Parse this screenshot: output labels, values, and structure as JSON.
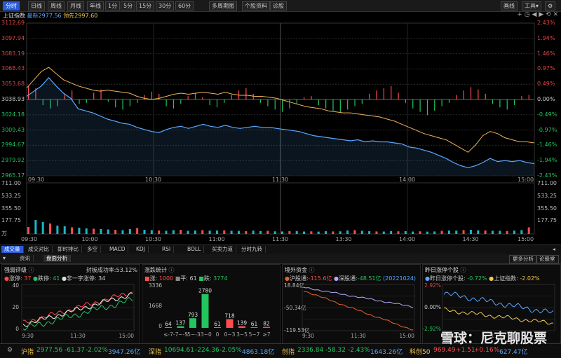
{
  "toolbar": {
    "tabs": [
      "分时",
      "日线",
      "周线",
      "月线",
      "年线",
      "1分",
      "5分",
      "15分",
      "30分",
      "60分"
    ],
    "more_period": "多周期图",
    "stock_info": "个股资料",
    "diagnose": "诊股",
    "draw_line": "画线",
    "tools": "工具",
    "tools_caret": "▾"
  },
  "legend": {
    "index_name": "上证指数",
    "latest_label": "最新",
    "latest_value": "2977.56",
    "lead_label": "领先",
    "lead_value": "2997.60"
  },
  "chart_data": {
    "type": "line",
    "price_levels": [
      "3112.69",
      "3097.94",
      "3083.19",
      "3068.43",
      "3053.68",
      "3038.93",
      "3024.18",
      "3009.43",
      "2994.67",
      "2979.92",
      "2965.17"
    ],
    "pct_levels": [
      "2.43%",
      "1.94%",
      "1.46%",
      "0.97%",
      "0.49%",
      "0.00%",
      "-0.49%",
      "-0.97%",
      "-1.46%",
      "-1.94%",
      "-2.43%"
    ],
    "prev_close": 3038.93,
    "time_labels": [
      "09:30",
      "10:30",
      "11:30",
      "14:00",
      "15:00"
    ],
    "volume_labels": [
      "711.00",
      "533.25",
      "355.50",
      "177.75",
      "万"
    ],
    "bottom_time_labels": [
      "09:30",
      "10:00",
      "10:30",
      "11:00",
      "11:30",
      "13:30",
      "14:00",
      "14:30",
      "15:00"
    ],
    "latest_series": [
      3042,
      3047,
      3052,
      3060,
      3052,
      3045,
      3040,
      3030,
      3028,
      3026,
      3023,
      3020,
      3018,
      3016,
      3015,
      3012,
      3010,
      3008,
      3007,
      3010,
      3012,
      3013,
      3011,
      3013,
      3015,
      3013,
      3012,
      3014,
      3012,
      3011,
      3012,
      3013,
      3012,
      3012,
      3011,
      3010,
      3009,
      3008,
      3006,
      3004,
      3003,
      3002,
      3001,
      3000,
      2999,
      3000,
      2998,
      2999,
      2998,
      2998,
      2997,
      2996,
      2993,
      2992,
      2990,
      2988,
      2985,
      2982,
      2978,
      2975,
      2973,
      2975,
      2978,
      2982,
      2979,
      2980,
      2979,
      2980,
      2978,
      2977
    ],
    "lead_series": [
      3050,
      3058,
      3066,
      3070,
      3064,
      3058,
      3055,
      3052,
      3050,
      3048,
      3047,
      3048,
      3047,
      3046,
      3045,
      3042,
      3040,
      3039,
      3040,
      3042,
      3044,
      3045,
      3044,
      3045,
      3046,
      3045,
      3044,
      3046,
      3044,
      3043,
      3043,
      3042,
      3042,
      3041,
      3040,
      3038,
      3036,
      3034,
      3032,
      3031,
      3030,
      3028,
      3027,
      3026,
      3026,
      3025,
      3024,
      3023,
      3022,
      3020,
      3018,
      3015,
      3012,
      3009,
      3006,
      3004,
      3002,
      3000,
      2996,
      2992,
      2988,
      2995,
      3004,
      3008,
      3006,
      3002,
      3000,
      2998,
      2998,
      2997
    ],
    "diff_bars": [
      12,
      10,
      -5,
      -8,
      -6,
      5,
      8,
      -4,
      -3,
      6,
      9,
      -2,
      -7,
      -9,
      -6,
      -3,
      4,
      7,
      5,
      -6,
      -8,
      -4,
      3,
      6,
      2,
      -5,
      -7,
      -3,
      4,
      8,
      10,
      5,
      -3,
      -6,
      -9,
      -11,
      -8,
      -4,
      2,
      3,
      -5,
      -8,
      -10,
      -12,
      -9,
      -6,
      -4,
      5,
      8,
      10,
      12,
      6,
      -3,
      -8,
      -11,
      -14,
      -10,
      -6,
      -3,
      4,
      8,
      11,
      9,
      5,
      -4,
      -7,
      -9,
      -5,
      3,
      4
    ],
    "volume_bars": [
      100,
      200,
      170,
      150,
      120,
      110,
      95,
      90,
      80,
      75,
      70,
      65,
      60,
      55,
      70,
      85,
      60,
      55,
      50,
      45,
      55,
      60,
      45,
      50,
      55,
      48,
      50,
      52,
      46,
      44,
      40,
      48,
      42,
      45,
      38,
      36,
      40,
      42,
      35,
      38,
      34,
      40,
      36,
      38,
      50,
      55,
      45,
      40,
      36,
      35,
      42,
      38,
      40,
      35,
      38,
      34,
      36,
      45,
      50,
      48,
      55,
      60,
      52,
      50,
      46,
      45,
      42,
      48,
      55,
      95
    ]
  },
  "indicator_tabs": [
    "成交量",
    "成交对比",
    "即时排比",
    "多空",
    "MACD",
    "KDJ",
    "RSI",
    "BOLL",
    "买卖力道",
    "分时九转"
  ],
  "panel_tabs": {
    "info": "资讯",
    "market": "盘面分析",
    "more": "更多分析",
    "forum": "论股堂"
  },
  "panels": {
    "strength": {
      "title": "强弱评级",
      "seal_label": "封板成功率:",
      "seal_rate": "53.12%",
      "rise_label": "涨停: ",
      "rise": "37",
      "fall_label": "跌停: ",
      "fall": "41",
      "one_label": "非一字涨停: ",
      "one": "34",
      "y_labels": [
        "40",
        "20",
        "0"
      ],
      "x_labels": [
        "9:30",
        "11:30",
        "15:00"
      ]
    },
    "stats": {
      "title": "涨跌统计",
      "up_label": "涨: ",
      "up": "1000",
      "flat_label": "平: ",
      "flat": "61",
      "down_label": "跌: ",
      "down": "3774",
      "y_labels": [
        "3336",
        "1668",
        "0"
      ],
      "dist_values": [
        64,
        137,
        793,
        2780,
        61,
        718,
        139,
        61,
        82
      ],
      "dist_labels": [
        "≤-7",
        "-7~-5",
        "-5~-3",
        "-3~0",
        "0",
        "0~3",
        "3~5",
        "5~7",
        "≥7"
      ]
    },
    "funds": {
      "title": "境外资金",
      "hgt_label": "沪股通:",
      "hgt": "-115.6亿",
      "sgt_label": "深股通:",
      "sgt": "-48.51亿",
      "date": "(20221024)",
      "y_top": "18.84亿",
      "y_mid": "-50.34亿",
      "y_bot": "-119.53亿",
      "x_labels": [
        "9:30",
        "11:30",
        "15:00"
      ]
    },
    "prev_limit": {
      "title": "昨日涨停个股",
      "l1_label": "昨日涨停个股: ",
      "l1": "-0.72%",
      "l2_label": "上证指数: ",
      "l2": "-2.02%",
      "y_labels": [
        "2.92%",
        "0.00%",
        "-2.92%"
      ],
      "x_labels": [
        "9:30",
        "11:30"
      ]
    }
  },
  "status_bar": {
    "sh_label": "沪指",
    "sh": "2977.56",
    "sh_chg": "-61.37",
    "sh_pct": "-2.02%",
    "sh_amt": "3947.26亿",
    "sz_label": "深指",
    "sz": "10694.61",
    "sz_chg": "-224.36",
    "sz_pct": "-2.05%",
    "sz_amt": "4863.18亿",
    "cy_label": "创指",
    "cy": "2336.84",
    "cy_chg": "-58.32",
    "cy_pct": "-2.43%",
    "cy_amt": "1643.26亿",
    "kc_label": "科创50",
    "kc": "969.49",
    "kc_chg": "+1.51",
    "kc_pct": "+0.16%",
    "kc_amt": "627.47亿"
  },
  "watermark": "雪球：尼克聊股票",
  "colors": {
    "up": "#ff4d4d",
    "down": "#22c55e",
    "lead": "#f2b45c",
    "latest": "#5aa9ff",
    "accent": "#2a5bd7"
  }
}
